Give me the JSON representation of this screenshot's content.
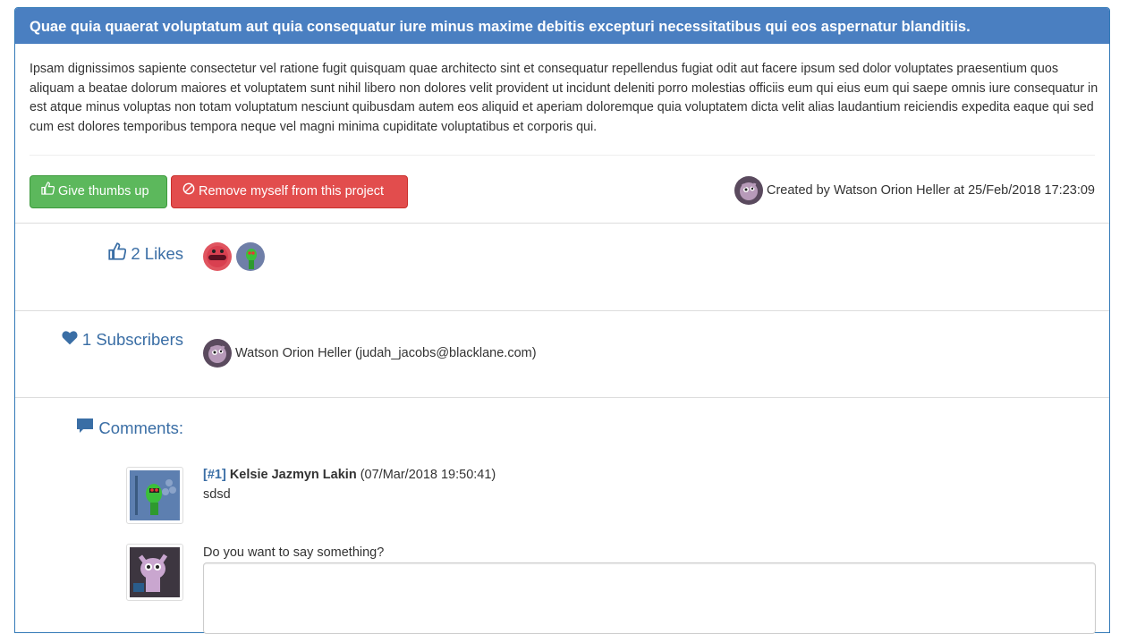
{
  "project": {
    "title": "Quae quia quaerat voluptatum aut quia consequatur iure minus maxime debitis excepturi necessitatibus qui eos aspernatur blanditiis.",
    "description": "Ipsam dignissimos sapiente consectetur vel ratione fugit quisquam quae architecto sint et consequatur repellendus fugiat odit aut facere ipsum sed dolor voluptates praesentium quos aliquam a beatae dolorum maiores et voluptatem sunt nihil libero non dolores velit provident ut incidunt deleniti porro molestias officiis eum qui eius eum qui saepe omnis iure consequatur in est atque minus voluptas non totam voluptatum nesciunt quibusdam autem eos aliquid et aperiam doloremque quia voluptatem dicta velit alias laudantium reiciendis expedita eaque qui sed cum est dolores temporibus tempora neque vel magni minima cupiditate voluptatibus et corporis qui."
  },
  "actions": {
    "thumbs_up_label": "Give thumbs up",
    "remove_label": "Remove myself from this project"
  },
  "created": {
    "text": "Created by Watson Orion Heller at 25/Feb/2018 17:23:09"
  },
  "likes": {
    "label": "2 Likes",
    "avatars": [
      "red-monster-avatar",
      "green-monster-avatar"
    ]
  },
  "subscribers": {
    "label": "1 Subscribers",
    "items": [
      {
        "text": "Watson Orion Heller (judah_jacobs@blacklane.com)"
      }
    ]
  },
  "comments": {
    "label": "Comments:",
    "items": [
      {
        "number": "[#1]",
        "author": "Kelsie Jazmyn Lakin",
        "timestamp": "(07/Mar/2018 19:50:41)",
        "text": "sdsd"
      }
    ],
    "prompt": "Do you want to say something?"
  },
  "colors": {
    "heading_bg": "#4a7fc1",
    "link": "#3a6ea5",
    "success": "#5cb85c",
    "danger": "#e24d4d"
  }
}
